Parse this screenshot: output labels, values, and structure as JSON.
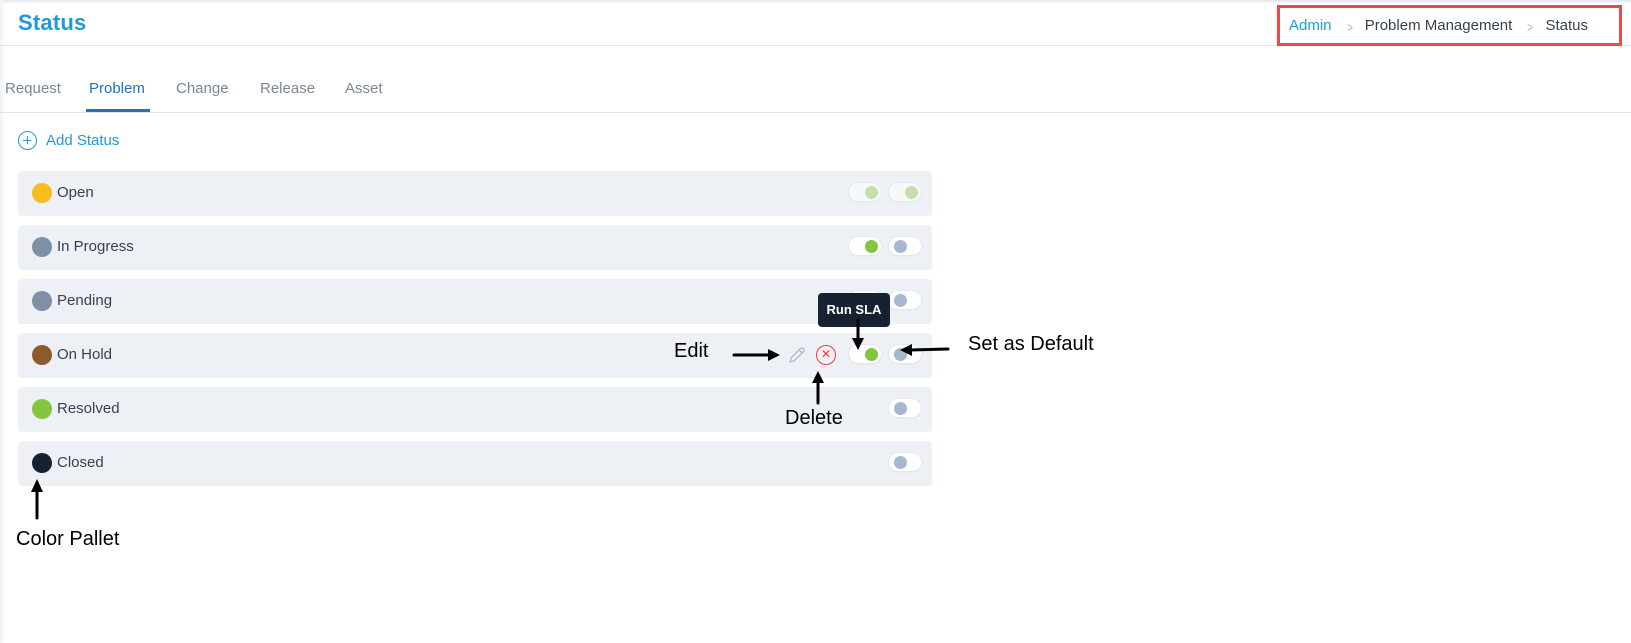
{
  "header": {
    "title": "Status",
    "breadcrumb": [
      {
        "label": "Admin",
        "link": true
      },
      {
        "label": "Problem Management",
        "link": false
      },
      {
        "label": "Status",
        "link": false
      }
    ],
    "breadcrumb_separator": ">"
  },
  "tabs": [
    {
      "label": "Request",
      "active": false
    },
    {
      "label": "Problem",
      "active": true
    },
    {
      "label": "Change",
      "active": false
    },
    {
      "label": "Release",
      "active": false
    },
    {
      "label": "Asset",
      "active": false
    }
  ],
  "add_status": {
    "label": "Add Status",
    "icon": "plus-circle-icon"
  },
  "statuses": [
    {
      "name": "Open",
      "color": "#f5bd1f",
      "run_sla": "on-disabled",
      "default": "on-disabled"
    },
    {
      "name": "In Progress",
      "color": "#7e90a6",
      "run_sla": "on",
      "default": "off"
    },
    {
      "name": "Pending",
      "color": "#7e90a6",
      "run_sla": "off",
      "default": "off"
    },
    {
      "name": "On Hold",
      "color": "#8d5a2c",
      "run_sla": "on",
      "default": "off",
      "hovered": true,
      "actions": [
        "edit",
        "delete"
      ]
    },
    {
      "name": "Resolved",
      "color": "#86c440",
      "default": "off"
    },
    {
      "name": "Closed",
      "color": "#172131",
      "default": "off"
    }
  ],
  "tooltip": {
    "text": "Run SLA"
  },
  "annotations": {
    "edit": "Edit",
    "delete": "Delete",
    "set_default": "Set as Default",
    "color_pallet": "Color Pallet"
  },
  "colors": {
    "accent": "#1f9ad6",
    "tab_active": "#2173c0",
    "row_bg": "#edf0f5",
    "toggle_on": "#84c441",
    "toggle_off_knob": "#a6b7cf",
    "delete": "#e8433f",
    "highlight_box": "#f0474b"
  }
}
